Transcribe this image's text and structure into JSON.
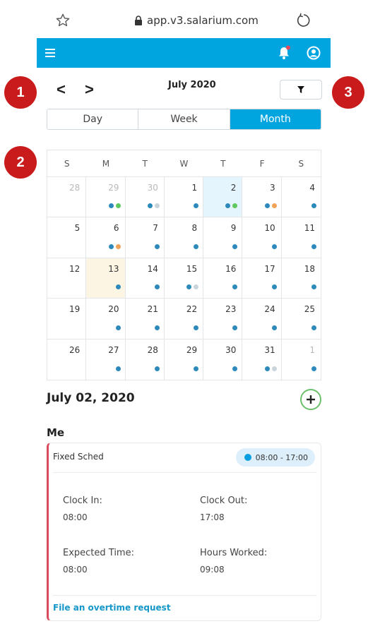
{
  "browser": {
    "url": "app.v3.salarium.com"
  },
  "colors": {
    "header": "#00a5e0",
    "marker": "#c91b1b",
    "blue": "#2c89b9",
    "green": "#5ec95e",
    "orange": "#f0a45a",
    "gray": "#c8d3da",
    "notify": "#e8485a"
  },
  "markers": [
    "1",
    "2",
    "3"
  ],
  "nav": {
    "prev": "<",
    "next": ">",
    "month": "July 2020"
  },
  "tabs": [
    "Day",
    "Week",
    "Month"
  ],
  "active_tab": "Month",
  "calendar": {
    "weekdays": [
      "S",
      "M",
      "T",
      "W",
      "T",
      "F",
      "S"
    ],
    "weeks": [
      [
        {
          "d": "28",
          "m": true,
          "dots": []
        },
        {
          "d": "29",
          "m": true,
          "dots": [
            "blue",
            "green"
          ]
        },
        {
          "d": "30",
          "m": true,
          "dots": [
            "blue",
            "gray"
          ]
        },
        {
          "d": "1",
          "dots": [
            "blue"
          ]
        },
        {
          "d": "2",
          "sel": true,
          "dots": [
            "blue",
            "green"
          ]
        },
        {
          "d": "3",
          "dots": [
            "blue",
            "orange"
          ]
        },
        {
          "d": "4",
          "dots": [
            "blue"
          ]
        }
      ],
      [
        {
          "d": "5",
          "dots": []
        },
        {
          "d": "6",
          "dots": [
            "blue",
            "orange"
          ]
        },
        {
          "d": "7",
          "dots": [
            "blue"
          ]
        },
        {
          "d": "8",
          "dots": [
            "blue"
          ]
        },
        {
          "d": "9",
          "dots": [
            "blue"
          ]
        },
        {
          "d": "10",
          "dots": [
            "blue"
          ]
        },
        {
          "d": "11",
          "dots": [
            "blue"
          ]
        }
      ],
      [
        {
          "d": "12",
          "dots": []
        },
        {
          "d": "13",
          "today": true,
          "dots": [
            "blue"
          ]
        },
        {
          "d": "14",
          "dots": [
            "blue"
          ]
        },
        {
          "d": "15",
          "dots": [
            "blue",
            "gray"
          ]
        },
        {
          "d": "16",
          "dots": [
            "blue"
          ]
        },
        {
          "d": "17",
          "dots": [
            "blue"
          ]
        },
        {
          "d": "18",
          "dots": [
            "blue"
          ]
        }
      ],
      [
        {
          "d": "19",
          "dots": []
        },
        {
          "d": "20",
          "dots": [
            "blue"
          ]
        },
        {
          "d": "21",
          "dots": [
            "blue"
          ]
        },
        {
          "d": "22",
          "dots": [
            "blue"
          ]
        },
        {
          "d": "23",
          "dots": [
            "blue"
          ]
        },
        {
          "d": "24",
          "dots": [
            "blue"
          ]
        },
        {
          "d": "25",
          "dots": [
            "blue"
          ]
        }
      ],
      [
        {
          "d": "26",
          "dots": []
        },
        {
          "d": "27",
          "dots": [
            "blue"
          ]
        },
        {
          "d": "28",
          "dots": [
            "blue"
          ]
        },
        {
          "d": "29",
          "dots": [
            "blue"
          ]
        },
        {
          "d": "30",
          "dots": [
            "blue"
          ]
        },
        {
          "d": "31",
          "dots": [
            "blue",
            "gray"
          ]
        },
        {
          "d": "1",
          "m": true,
          "dots": [
            "blue"
          ]
        }
      ]
    ]
  },
  "detail": {
    "date": "July 02, 2020",
    "section": "Me",
    "card": {
      "title": "Fixed Sched",
      "time_range": "08:00 - 17:00",
      "clock_in_label": "Clock In:",
      "clock_in": "08:00",
      "clock_out_label": "Clock Out:",
      "clock_out": "17:08",
      "expected_label": "Expected Time:",
      "expected": "08:00",
      "hours_label": "Hours Worked:",
      "hours": "09:08",
      "link": "File an overtime request"
    }
  }
}
